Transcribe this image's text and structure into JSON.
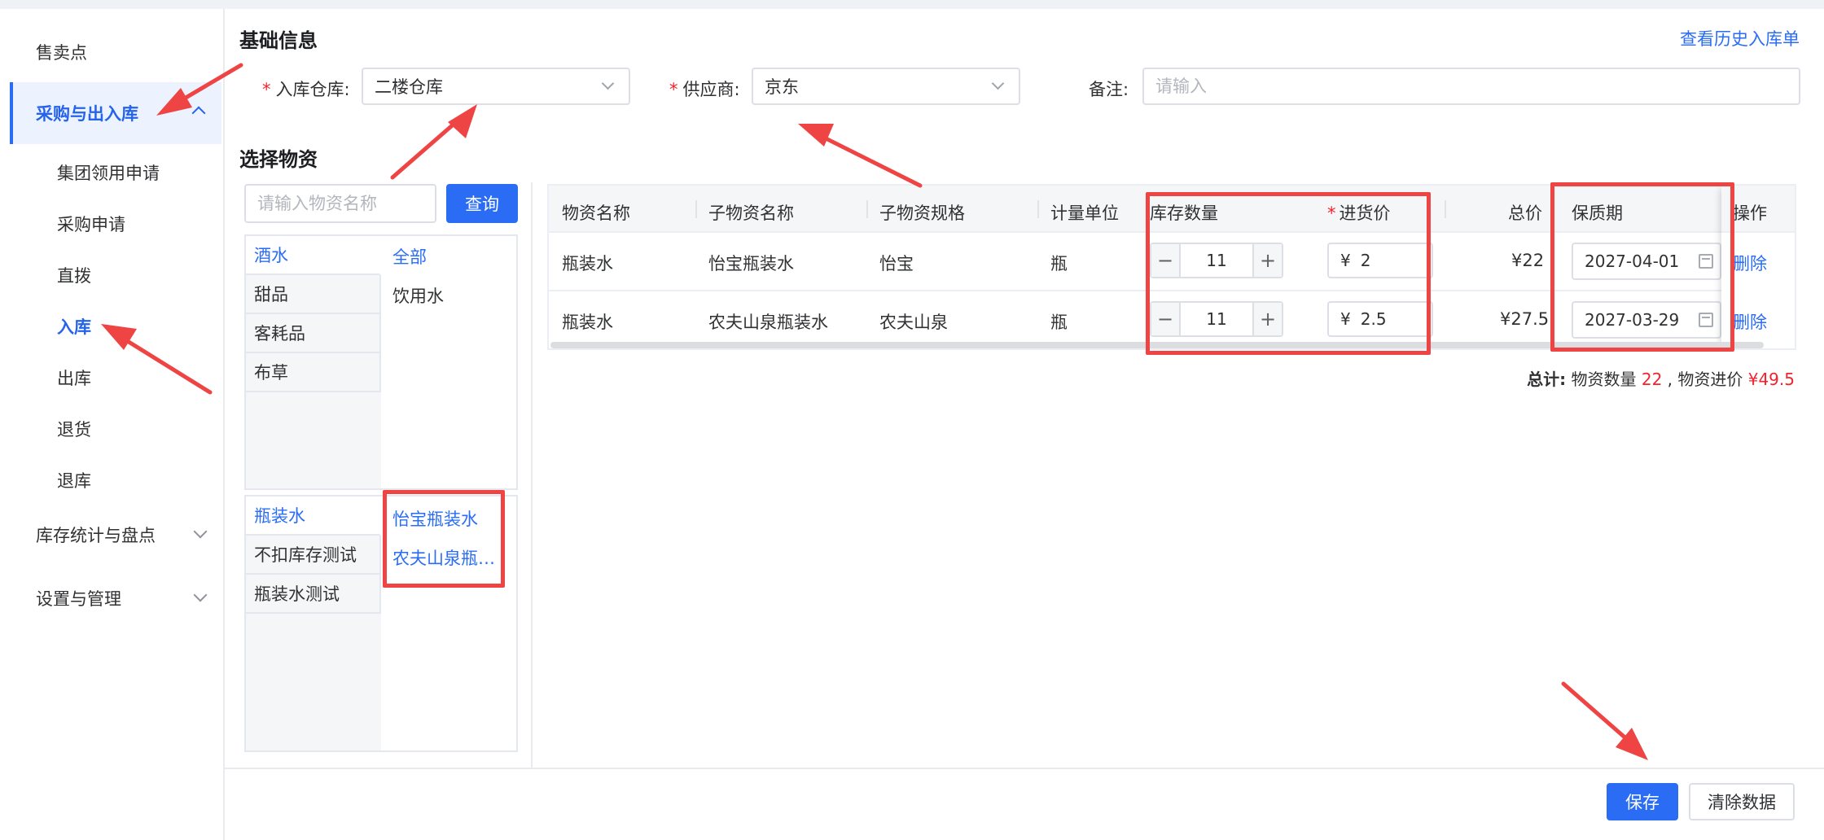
{
  "sidebar": {
    "items": [
      {
        "label": "售卖点"
      },
      {
        "label": "采购与出入库"
      },
      {
        "label": "库存统计与盘点"
      },
      {
        "label": "设置与管理"
      }
    ],
    "sub_items": [
      {
        "label": "集团领用申请"
      },
      {
        "label": "采购申请"
      },
      {
        "label": "直拨"
      },
      {
        "label": "入库"
      },
      {
        "label": "出库"
      },
      {
        "label": "退货"
      },
      {
        "label": "退库"
      }
    ]
  },
  "basic": {
    "title": "基础信息",
    "history_link": "查看历史入库单",
    "warehouse_label": "入库仓库:",
    "warehouse_value": "二楼仓库",
    "supplier_label": "供应商:",
    "supplier_value": "京东",
    "remark_label": "备注:",
    "remark_placeholder": "请输入",
    "required_mark": "*"
  },
  "picker": {
    "title": "选择物资",
    "search_placeholder": "请输入物资名称",
    "search_button": "查询",
    "categories_top": [
      "酒水",
      "甜品",
      "客耗品",
      "布草"
    ],
    "subcategories_top": [
      "全部",
      "饮用水"
    ],
    "categories_bottom": [
      "瓶装水",
      "不扣库存测试",
      "瓶装水测试"
    ],
    "items_bottom": [
      "怡宝瓶装水",
      "农夫山泉瓶…"
    ]
  },
  "table": {
    "headers": {
      "name": "物资名称",
      "sub_name": "子物资名称",
      "spec": "子物资规格",
      "unit": "计量单位",
      "stock_qty": "库存数量",
      "price": "进货价",
      "total": "总价",
      "shelf_life": "保质期",
      "action": "操作"
    },
    "currency": "¥",
    "minus": "−",
    "plus": "+",
    "rows": [
      {
        "name": "瓶装水",
        "sub_name": "怡宝瓶装水",
        "spec": "怡宝",
        "unit": "瓶",
        "qty": "11",
        "price": "2",
        "total": "¥22",
        "date": "2027-04-01",
        "action": "删除"
      },
      {
        "name": "瓶装水",
        "sub_name": "农夫山泉瓶装水",
        "spec": "农夫山泉",
        "unit": "瓶",
        "qty": "11",
        "price": "2.5",
        "total": "¥27.5",
        "date": "2027-03-29",
        "action": "删除"
      }
    ]
  },
  "summary": {
    "label": "总计:",
    "qty_label": "物资数量",
    "qty_value": "22",
    "sep": ",",
    "price_label": "物资进价",
    "price_value": "¥49.5"
  },
  "footer": {
    "save": "保存",
    "clear": "清除数据"
  },
  "colors": {
    "primary": "#2a6df4",
    "annotation": "#ef4444",
    "danger": "#f5222d"
  }
}
